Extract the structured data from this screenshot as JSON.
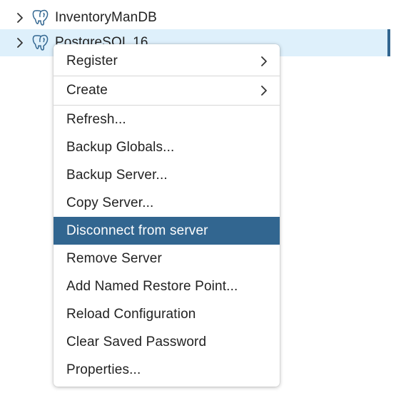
{
  "tree": {
    "items": [
      {
        "label": "InventoryManDB",
        "icon": "postgres-elephant-icon",
        "selected": false
      },
      {
        "label": "PostgreSQL 16",
        "icon": "postgres-elephant-icon",
        "selected": true
      }
    ]
  },
  "context_menu": {
    "items": [
      {
        "label": "Register",
        "has_submenu": true
      },
      {
        "label": "Create",
        "has_submenu": true
      },
      {
        "label": "Refresh..."
      },
      {
        "label": "Backup Globals..."
      },
      {
        "label": "Backup Server..."
      },
      {
        "label": "Copy Server..."
      },
      {
        "label": "Disconnect from server",
        "highlighted": true
      },
      {
        "label": "Remove Server"
      },
      {
        "label": "Add Named Restore Point..."
      },
      {
        "label": "Reload Configuration"
      },
      {
        "label": "Clear Saved Password"
      },
      {
        "label": "Properties..."
      }
    ]
  },
  "colors": {
    "accent": "#326690",
    "selected_row": "#def0fb",
    "icon": "#336791"
  }
}
